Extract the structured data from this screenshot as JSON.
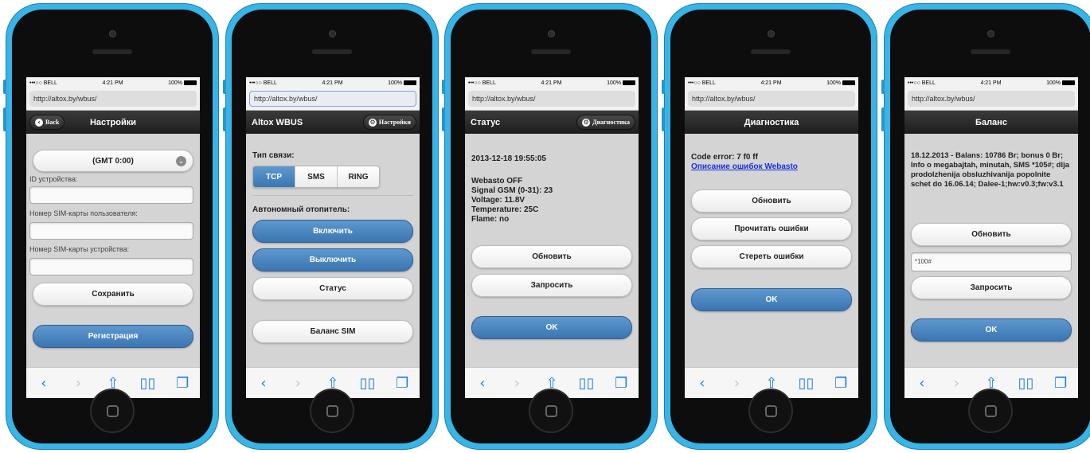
{
  "status_bar": {
    "carrier": "•••○○ BELL",
    "wifi": "ᯤ",
    "time": "4:21 PM",
    "battery": "100%"
  },
  "url": "http://altox.by/wbus/",
  "screens": {
    "settings": {
      "title": "Настройки",
      "back_label": "Back",
      "timezone": "(GMT 0:00)",
      "device_id_label": "ID устройства:",
      "user_sim_label": "Номер SIM-карты пользователя:",
      "device_sim_label": "Номер SIM-карты устройства:",
      "save_label": "Сохранить",
      "register_label": "Регистрация"
    },
    "main": {
      "title": "Altox WBUS",
      "settings_btn": "Настройки",
      "conn_type_label": "Тип связи:",
      "conn_options": [
        "TCP",
        "SMS",
        "RING"
      ],
      "conn_selected": "TCP",
      "heater_label": "Автономный отопитель:",
      "on_label": "Включить",
      "off_label": "Выключить",
      "status_label": "Статус",
      "balance_label": "Баланс SIM"
    },
    "status": {
      "title": "Статус",
      "diag_btn": "Диагностика",
      "datetime": "2013-12-18 19:55:05",
      "lines": [
        "Webasto OFF",
        "Signal GSM (0-31): 23",
        "Voltage: 11.8V",
        "Temperature: 25C",
        "Flame: no"
      ],
      "refresh_label": "Обновить",
      "request_label": "Запросить",
      "ok_label": "OK"
    },
    "diagnostics": {
      "title": "Диагностика",
      "code_error": "Code error: 7 f0 ff",
      "link_text": "Описание ошибок Webasto",
      "refresh_label": "Обновить",
      "read_errors_label": "Прочитать ошибки",
      "clear_errors_label": "Стереть ошибки",
      "ok_label": "OK"
    },
    "balance": {
      "title": "Баланс",
      "message": "18.12.2013 - Balans: 10786 Br; bonus 0 Br; Info o megabajtah, minutah, SMS *105#; dlja prodolzhenija obsluzhivanija popolnite schet do 16.06.14; Dalee-1;hw:v0.3;fw:v3.1",
      "refresh_label": "Обновить",
      "ussd_value": "*100#",
      "request_label": "Запросить",
      "ok_label": "OK"
    }
  },
  "toolbar_icons": [
    "back-icon",
    "forward-icon",
    "share-icon",
    "bookmarks-icon",
    "tabs-icon"
  ],
  "colors": {
    "phone": "#38b4e6",
    "accent_button": "#4a86c2",
    "header": "#2b2b2b",
    "link": "#1a2ee0"
  }
}
